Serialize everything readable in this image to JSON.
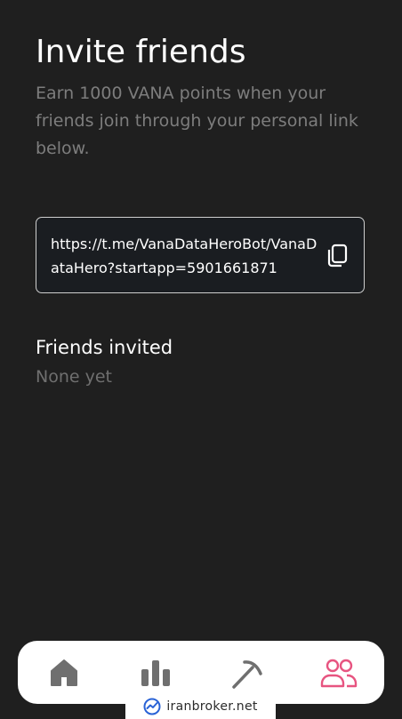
{
  "header": {
    "title": "Invite friends",
    "subtitle": "Earn 1000 VANA points when your friends join through your personal link below."
  },
  "referral": {
    "link": "https://t.me/VanaDataHeroBot/VanaDataHero?startapp=5901661871",
    "copy_icon": "copy-icon"
  },
  "friends": {
    "title": "Friends invited",
    "empty_text": "None yet"
  },
  "navbar": {
    "items": [
      {
        "icon": "home-icon",
        "active": false
      },
      {
        "icon": "bar-chart-icon",
        "active": false
      },
      {
        "icon": "pickaxe-icon",
        "active": false
      },
      {
        "icon": "users-icon",
        "active": true
      }
    ]
  },
  "watermark": {
    "text": "iranbroker.net"
  },
  "colors": {
    "background": "#1f1f1f",
    "inactive_icon": "#6f6f6f",
    "active_icon": "#e75480"
  }
}
